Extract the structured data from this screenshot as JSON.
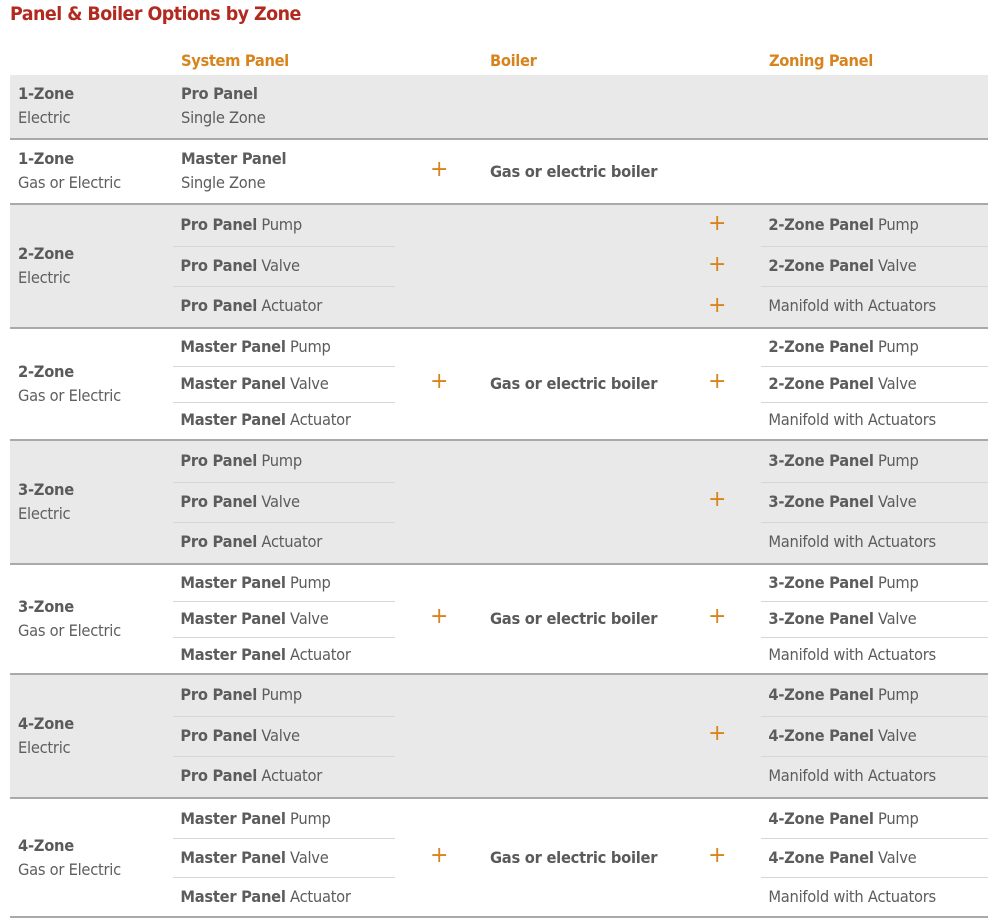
{
  "title": "Panel & Boiler Options by Zone",
  "headers": {
    "system_panel": "System Panel",
    "boiler": "Boiler",
    "zoning_panel": "Zoning Panel"
  },
  "plus_symbol": "+",
  "colors": {
    "title": "#b22a1f",
    "header": "#d8841e",
    "plus": "#d8841e",
    "row_gray": "#e9e9e9",
    "text": "#595959"
  },
  "rows": [
    {
      "zone": "1-Zone",
      "type": "Electric",
      "shade": "gray",
      "system_panel": {
        "bold": "Pro Panel",
        "sub": "Single Zone"
      },
      "boiler": null,
      "zoning": []
    },
    {
      "zone": "1-Zone",
      "type": "Gas or Electric",
      "shade": "white",
      "system_panel": {
        "bold": "Master Panel",
        "sub": "Single Zone"
      },
      "boiler": "Gas or electric boiler",
      "zoning": []
    },
    {
      "zone": "2-Zone",
      "type": "Electric",
      "shade": "gray",
      "system_panels": [
        {
          "bold": "Pro Panel",
          "rest": " Pump"
        },
        {
          "bold": "Pro Panel",
          "rest": " Valve"
        },
        {
          "bold": "Pro Panel",
          "rest": " Actuator"
        }
      ],
      "boiler": null,
      "zoning": [
        {
          "bold": "2-Zone Panel",
          "rest": " Pump"
        },
        {
          "bold": "2-Zone Panel",
          "rest": " Valve"
        },
        {
          "bold": "",
          "rest": "Manifold with Actuators"
        }
      ]
    },
    {
      "zone": "2-Zone",
      "type": "Gas or Electric",
      "shade": "white",
      "system_panels": [
        {
          "bold": "Master Panel",
          "rest": " Pump"
        },
        {
          "bold": "Master Panel",
          "rest": " Valve"
        },
        {
          "bold": "Master Panel",
          "rest": " Actuator"
        }
      ],
      "boiler": "Gas or electric boiler",
      "zoning": [
        {
          "bold": "2-Zone Panel",
          "rest": " Pump"
        },
        {
          "bold": "2-Zone Panel",
          "rest": " Valve"
        },
        {
          "bold": "",
          "rest": "Manifold with Actuators"
        }
      ]
    },
    {
      "zone": "3-Zone",
      "type": "Electric",
      "shade": "gray",
      "system_panels": [
        {
          "bold": "Pro Panel",
          "rest": " Pump"
        },
        {
          "bold": "Pro Panel",
          "rest": " Valve"
        },
        {
          "bold": "Pro Panel",
          "rest": " Actuator"
        }
      ],
      "boiler": null,
      "zoning": [
        {
          "bold": "3-Zone Panel",
          "rest": " Pump"
        },
        {
          "bold": "3-Zone Panel",
          "rest": " Valve"
        },
        {
          "bold": "",
          "rest": "Manifold with Actuators"
        }
      ]
    },
    {
      "zone": "3-Zone",
      "type": "Gas or Electric",
      "shade": "white",
      "system_panels": [
        {
          "bold": "Master Panel",
          "rest": " Pump"
        },
        {
          "bold": "Master Panel",
          "rest": " Valve"
        },
        {
          "bold": "Master Panel",
          "rest": " Actuator"
        }
      ],
      "boiler": "Gas or electric boiler",
      "zoning": [
        {
          "bold": "3-Zone Panel",
          "rest": " Pump"
        },
        {
          "bold": "3-Zone Panel",
          "rest": " Valve"
        },
        {
          "bold": "",
          "rest": "Manifold with Actuators"
        }
      ]
    },
    {
      "zone": "4-Zone",
      "type": "Electric",
      "shade": "gray",
      "system_panels": [
        {
          "bold": "Pro Panel",
          "rest": " Pump"
        },
        {
          "bold": "Pro Panel",
          "rest": " Valve"
        },
        {
          "bold": "Pro Panel",
          "rest": " Actuator"
        }
      ],
      "boiler": null,
      "zoning": [
        {
          "bold": "4-Zone Panel",
          "rest": " Pump"
        },
        {
          "bold": "4-Zone Panel",
          "rest": " Valve"
        },
        {
          "bold": "",
          "rest": "Manifold with Actuators"
        }
      ]
    },
    {
      "zone": "4-Zone",
      "type": "Gas or Electric",
      "shade": "white",
      "system_panels": [
        {
          "bold": "Master Panel",
          "rest": " Pump"
        },
        {
          "bold": "Master Panel",
          "rest": " Valve"
        },
        {
          "bold": "Master Panel",
          "rest": " Actuator"
        }
      ],
      "boiler": "Gas or electric boiler",
      "zoning": [
        {
          "bold": "4-Zone Panel",
          "rest": " Pump"
        },
        {
          "bold": "4-Zone Panel",
          "rest": " Valve"
        },
        {
          "bold": "",
          "rest": "Manifold with Actuators"
        }
      ]
    }
  ]
}
